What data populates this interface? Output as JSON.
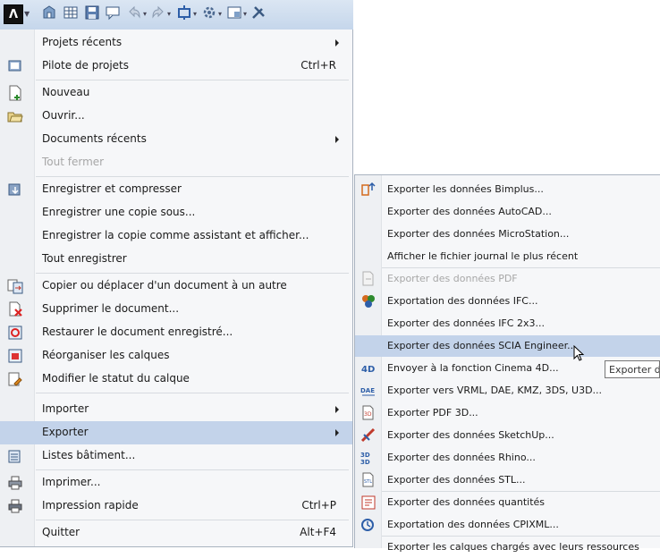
{
  "toolbar": {
    "app_button_label": "Λ",
    "icons": [
      "building-icon",
      "grid-icon",
      "save-icon",
      "speech-icon",
      "undo-icon",
      "redo-icon",
      "move-icon",
      "settings-icon",
      "layout-icon",
      "tools-icon"
    ]
  },
  "menu": {
    "items": [
      {
        "label": "Projets récents",
        "submenu": true
      },
      {
        "label": "Pilote de projets",
        "shortcut": "Ctrl+R"
      },
      {
        "label": "Nouveau"
      },
      {
        "label": "Ouvrir..."
      },
      {
        "label": "Documents récents",
        "submenu": true
      },
      {
        "label": "Tout fermer",
        "disabled": true
      },
      {
        "label": "Enregistrer et compresser"
      },
      {
        "label": "Enregistrer une copie sous..."
      },
      {
        "label": "Enregistrer la copie comme assistant et afficher..."
      },
      {
        "label": "Tout enregistrer"
      },
      {
        "label": "Copier ou déplacer d'un document à un autre"
      },
      {
        "label": "Supprimer le document..."
      },
      {
        "label": "Restaurer le document enregistré..."
      },
      {
        "label": "Réorganiser les calques"
      },
      {
        "label": "Modifier le statut du calque"
      },
      {
        "label": "Importer",
        "submenu": true
      },
      {
        "label": "Exporter",
        "submenu": true,
        "highlighted": true
      },
      {
        "label": "Listes bâtiment..."
      },
      {
        "label": "Imprimer..."
      },
      {
        "label": "Impression rapide",
        "shortcut": "Ctrl+P"
      },
      {
        "label": "Quitter",
        "shortcut": "Alt+F4"
      }
    ]
  },
  "submenu": {
    "items": [
      {
        "label": "Exporter les données Bimplus..."
      },
      {
        "label": "Exporter des données AutoCAD..."
      },
      {
        "label": "Exporter des données MicroStation..."
      },
      {
        "label": "Afficher le fichier journal le plus récent"
      },
      {
        "label": "Exporter des données PDF",
        "disabled": true
      },
      {
        "label": "Exportation des données IFC..."
      },
      {
        "label": "Exporter des données IFC 2x3..."
      },
      {
        "label": "Exporter des données SCIA Engineer...",
        "highlighted": true
      },
      {
        "label": "Envoyer à la fonction Cinema 4D..."
      },
      {
        "label": "Exporter vers VRML, DAE, KMZ, 3DS, U3D..."
      },
      {
        "label": "Exporter PDF 3D..."
      },
      {
        "label": "Exporter des données SketchUp..."
      },
      {
        "label": "Exporter des données Rhino..."
      },
      {
        "label": "Exporter des données STL..."
      },
      {
        "label": "Exporter des données quantités"
      },
      {
        "label": "Exportation des données CPIXML..."
      },
      {
        "label": "Exporter les calques chargés avec leurs ressources"
      }
    ]
  },
  "tooltip": {
    "text": "Exporter d"
  },
  "colors": {
    "highlight": "#c3d3ea",
    "disabled": "#a7a7a7",
    "toolbar": "#c5d6eb"
  }
}
